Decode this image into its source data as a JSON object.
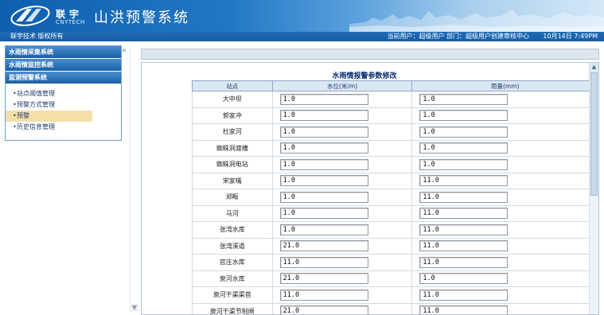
{
  "header": {
    "logo_cn": "联宇",
    "logo_en": "CNYTECH",
    "app_title": "山洪预警系统"
  },
  "infobar": {
    "copyright": "联宇技术 版权所有",
    "user_info": "当前用户：超级用户  部门：超级用户创建审核中心",
    "datetime": "10月14日 7:49PM"
  },
  "sidebar": {
    "systems": [
      {
        "label": "水雨情采集系统"
      },
      {
        "label": "水雨情监控系统"
      },
      {
        "label": "监测预警系统"
      }
    ],
    "items": [
      {
        "label": "站点阈值管理"
      },
      {
        "label": "预警方式管理"
      },
      {
        "label": "预警"
      },
      {
        "label": "历史信息管理"
      }
    ],
    "active_item": "预警"
  },
  "form": {
    "title": "水雨情报警参数修改",
    "columns": [
      "站点",
      "水位(米/m)",
      "雨量(mm)"
    ],
    "rows": [
      {
        "station": "大中坝",
        "water_level": "1.0",
        "rainfall": "1.0"
      },
      {
        "station": "郭家冲",
        "water_level": "1.0",
        "rainfall": "1.0"
      },
      {
        "station": "杜家河",
        "water_level": "1.0",
        "rainfall": "1.0"
      },
      {
        "station": "蜘蛛洞渡槽",
        "water_level": "1.0",
        "rainfall": "1.0"
      },
      {
        "station": "蜘蛛洞电站",
        "water_level": "1.0",
        "rainfall": "1.0"
      },
      {
        "station": "宋家嘴",
        "water_level": "1.0",
        "rainfall": "11.0"
      },
      {
        "station": "郑畈",
        "water_level": "1.0",
        "rainfall": "11.0"
      },
      {
        "station": "马河",
        "water_level": "1.0",
        "rainfall": "11.0"
      },
      {
        "station": "张湾水库",
        "water_level": "1.0",
        "rainfall": "11.0"
      },
      {
        "station": "张湾溪道",
        "water_level": "21.0",
        "rainfall": "11.0"
      },
      {
        "station": "官庄水库",
        "water_level": "11.0",
        "rainfall": "11.0"
      },
      {
        "station": "泉河水库",
        "water_level": "21.0",
        "rainfall": "1.0"
      },
      {
        "station": "泉河干渠渠首",
        "water_level": "11.0",
        "rainfall": "11.0"
      },
      {
        "station": "泉河干渠节制闸",
        "water_level": "21.0",
        "rainfall": "11.0"
      }
    ]
  },
  "colors": {
    "header_blue": "#1565b3",
    "sidebar_header": "#1a5fa6",
    "active_highlight": "#f5dfa9",
    "title_text": "#0b2f72"
  },
  "icons": {
    "collapse": "double-chevron-left-icon",
    "scroll_up": "scroll-up-icon",
    "scroll_down": "scroll-down-icon",
    "bullet": "bullet-icon"
  }
}
